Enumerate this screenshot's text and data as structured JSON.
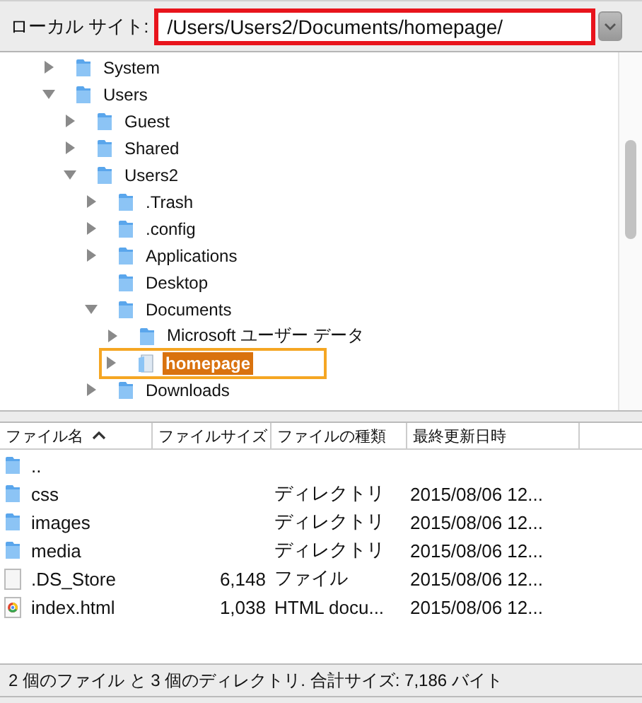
{
  "site_bar": {
    "label": "ローカル サイト:",
    "path": "/Users/Users2/Documents/homepage/",
    "highlighted": true
  },
  "tree": [
    {
      "name": "System",
      "kind": "branch",
      "expanded": false,
      "selected": false,
      "highlighted": false
    },
    {
      "name": "Users",
      "kind": "branch",
      "expanded": true,
      "selected": false,
      "highlighted": false,
      "children": [
        {
          "name": "Guest",
          "kind": "branch",
          "expanded": false,
          "selected": false,
          "highlighted": false
        },
        {
          "name": "Shared",
          "kind": "branch",
          "expanded": false,
          "selected": false,
          "highlighted": false
        },
        {
          "name": "Users2",
          "kind": "branch",
          "expanded": true,
          "selected": false,
          "highlighted": false,
          "children": [
            {
              "name": ".Trash",
              "kind": "branch",
              "expanded": false,
              "selected": false,
              "highlighted": false
            },
            {
              "name": ".config",
              "kind": "branch",
              "expanded": false,
              "selected": false,
              "highlighted": false
            },
            {
              "name": "Applications",
              "kind": "branch",
              "expanded": false,
              "selected": false,
              "highlighted": false
            },
            {
              "name": "Desktop",
              "kind": "leaf",
              "selected": false,
              "highlighted": false
            },
            {
              "name": "Documents",
              "kind": "branch",
              "expanded": true,
              "selected": false,
              "highlighted": false,
              "children": [
                {
                  "name": "Microsoft ユーザー データ",
                  "kind": "branch",
                  "expanded": false,
                  "selected": false,
                  "highlighted": false
                },
                {
                  "name": "homepage",
                  "kind": "branch",
                  "expanded": false,
                  "selected": true,
                  "highlighted": true
                }
              ]
            },
            {
              "name": "Downloads",
              "kind": "branch",
              "expanded": false,
              "selected": false,
              "highlighted": false
            }
          ]
        }
      ]
    }
  ],
  "file_list": {
    "columns": [
      {
        "label": "ファイル名",
        "sorted": true
      },
      {
        "label": "ファイルサイズ",
        "sorted": false
      },
      {
        "label": "ファイルの種類",
        "sorted": false
      },
      {
        "label": "最終更新日時",
        "sorted": false
      }
    ],
    "rows": [
      {
        "kind": "folder",
        "name": ".."
      },
      {
        "kind": "folder",
        "name": "css",
        "type": "ディレクトリ",
        "modified": "2015/08/06 12..."
      },
      {
        "kind": "folder",
        "name": "images",
        "type": "ディレクトリ",
        "modified": "2015/08/06 12..."
      },
      {
        "kind": "folder",
        "name": "media",
        "type": "ディレクトリ",
        "modified": "2015/08/06 12..."
      },
      {
        "kind": "file",
        "name": ".DS_Store",
        "size": "6,148",
        "type": "ファイル",
        "modified": "2015/08/06 12..."
      },
      {
        "kind": "html",
        "name": "index.html",
        "size": "1,038",
        "type": "HTML docu...",
        "modified": "2015/08/06 12..."
      }
    ]
  },
  "status_bar": "2 個のファイル と 3 個のディレクトリ. 合計サイズ: 7,186 バイト"
}
